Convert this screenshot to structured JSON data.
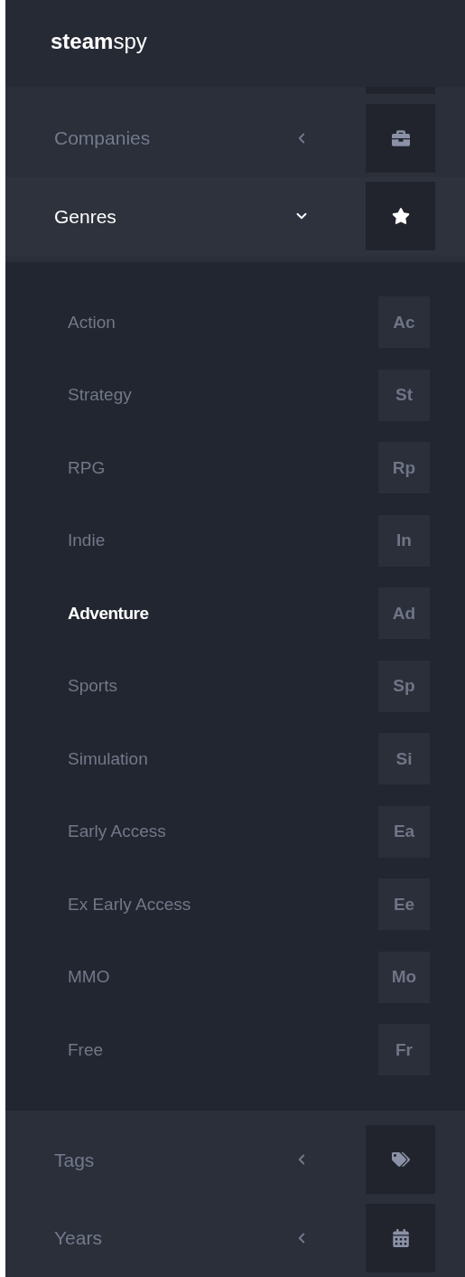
{
  "logo": "**steam**spy",
  "menus": [
    {
      "label": "Companies",
      "expanded": false
    },
    {
      "label": "Genres",
      "expanded": true,
      "children": [
        {
          "label": "Action",
          "abbr": "Ac",
          "selected": false
        },
        {
          "label": "Strategy",
          "abbr": "St",
          "selected": false
        },
        {
          "label": "RPG",
          "abbr": "Rp",
          "selected": false
        },
        {
          "label": "Indie",
          "abbr": "In",
          "selected": false
        },
        {
          "label": "Adventure",
          "abbr": "Ad",
          "selected": true
        },
        {
          "label": "Sports",
          "abbr": "Sp",
          "selected": false
        },
        {
          "label": "Simulation",
          "abbr": "Si",
          "selected": false
        },
        {
          "label": "Early Access",
          "abbr": "Ea",
          "selected": false
        },
        {
          "label": "Ex Early Access",
          "abbr": "Ee",
          "selected": false
        },
        {
          "label": "MMO",
          "abbr": "Mo",
          "selected": false
        },
        {
          "label": "Free",
          "abbr": "Fr",
          "selected": false
        }
      ]
    },
    {
      "label": "Tags",
      "expanded": false
    },
    {
      "label": "Years",
      "expanded": false
    }
  ]
}
